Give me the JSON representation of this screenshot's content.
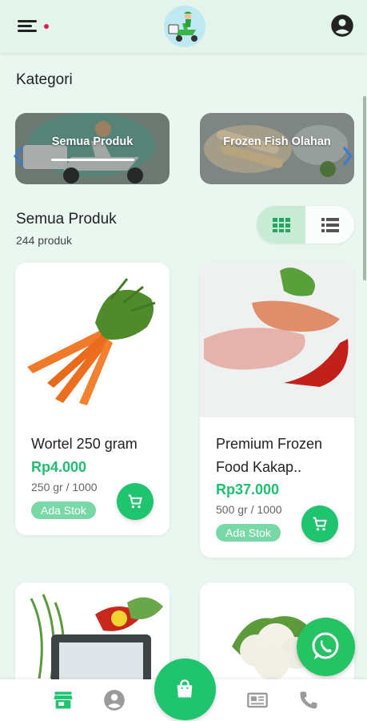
{
  "header": {
    "menu_icon": "menu-icon",
    "logo_icon": "delivery-scooter-logo",
    "account_icon": "account-circle-icon"
  },
  "categories": {
    "title": "Kategori",
    "items": [
      {
        "label": "Semua Produk",
        "active": true
      },
      {
        "label": "Frozen Fish Olahan",
        "active": false
      }
    ]
  },
  "products": {
    "title": "Semua Produk",
    "count": "244 produk",
    "view_modes": [
      "grid-view-icon",
      "list-view-icon"
    ],
    "active_view": "grid",
    "items": [
      {
        "name": "Wortel 250 gram",
        "price": "Rp4.000",
        "weight": "250 gr / 1000",
        "stock": "Ada Stok"
      },
      {
        "name_line1": "Premium Frozen",
        "name_line2": "Food Kakap..",
        "price": "Rp37.000",
        "weight": "500 gr / 1000",
        "stock": "Ada Stok"
      }
    ]
  },
  "bottom_nav": {
    "items": [
      "store-icon",
      "account-icon",
      "shopping-bag-icon",
      "news-icon",
      "phone-icon"
    ],
    "active": "store-icon"
  },
  "colors": {
    "accent": "#1fc46f",
    "price": "#1fbf6f",
    "background": "#eaf6f0",
    "badge": "#79d9a6",
    "notification_dot": "#e2185b"
  }
}
